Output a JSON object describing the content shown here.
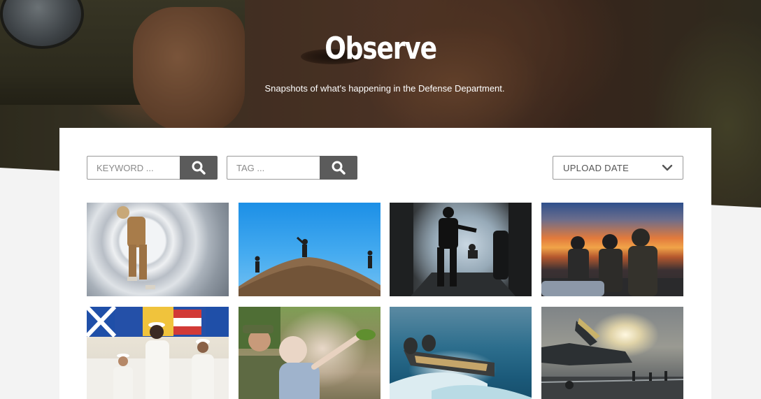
{
  "hero": {
    "title": "Observe",
    "subtitle": "Snapshots of what’s happening in the Defense Department."
  },
  "filters": {
    "keyword": {
      "placeholder": "KEYWORD ...",
      "value": "",
      "button_icon": "search-icon"
    },
    "tag": {
      "placeholder": "TAG ...",
      "value": "",
      "button_icon": "search-icon"
    },
    "sort": {
      "selected": "UPLOAD DATE",
      "icon": "chevron-down-icon"
    }
  },
  "colors": {
    "button_bg": "#5b5b5b",
    "card_bg": "#ffffff",
    "page_bg": "#f3f3f3",
    "hero_text": "#ffffff"
  }
}
